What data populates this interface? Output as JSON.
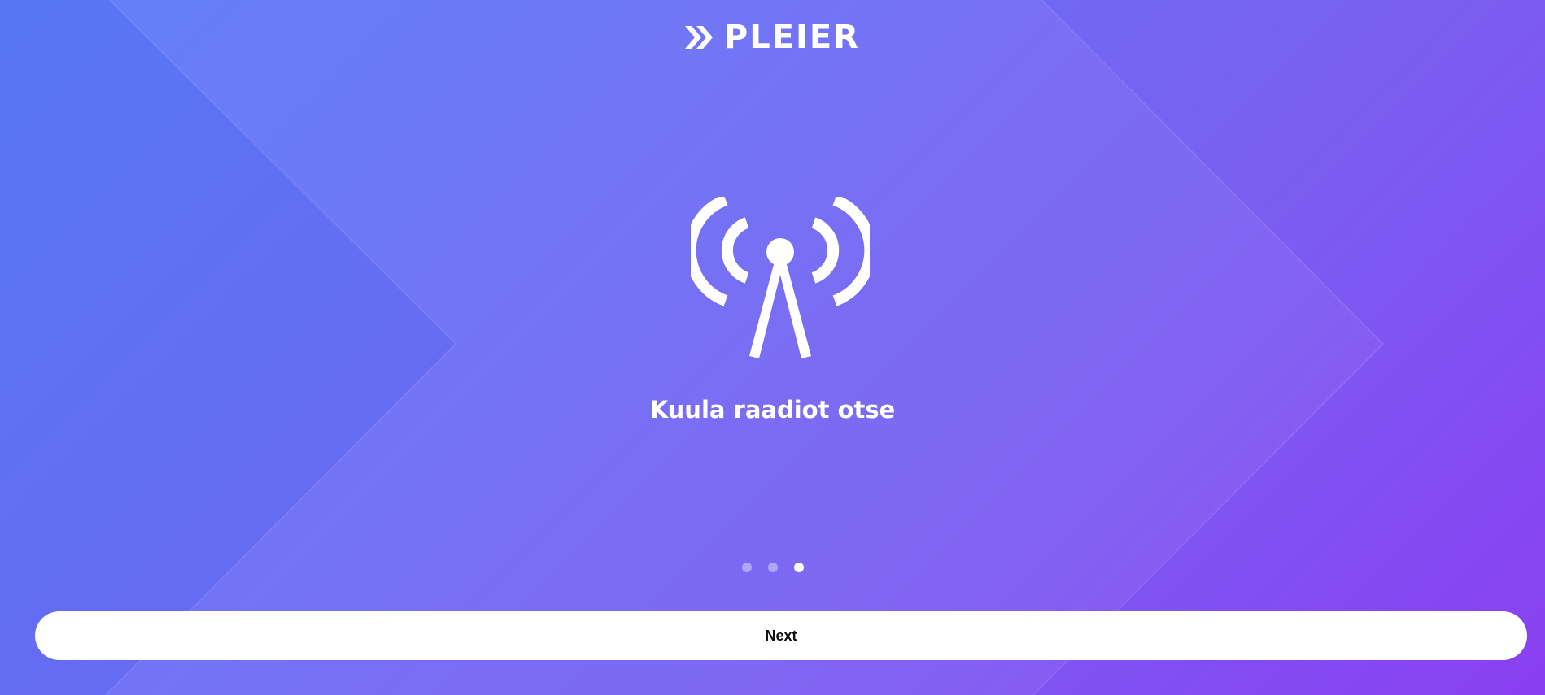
{
  "brand": {
    "logo_icon": "double-chevron-right-icon",
    "name": "PLEIER"
  },
  "slide": {
    "icon": "radio-tower-icon",
    "title": "Kuula raadiot otse"
  },
  "pager": {
    "total": 3,
    "active_index": 2
  },
  "actions": {
    "next_label": "Next"
  },
  "colors": {
    "gradient_start": "#5a7bf6",
    "gradient_end": "#8a3ff2",
    "foreground": "#ffffff",
    "button_text": "#111111"
  }
}
